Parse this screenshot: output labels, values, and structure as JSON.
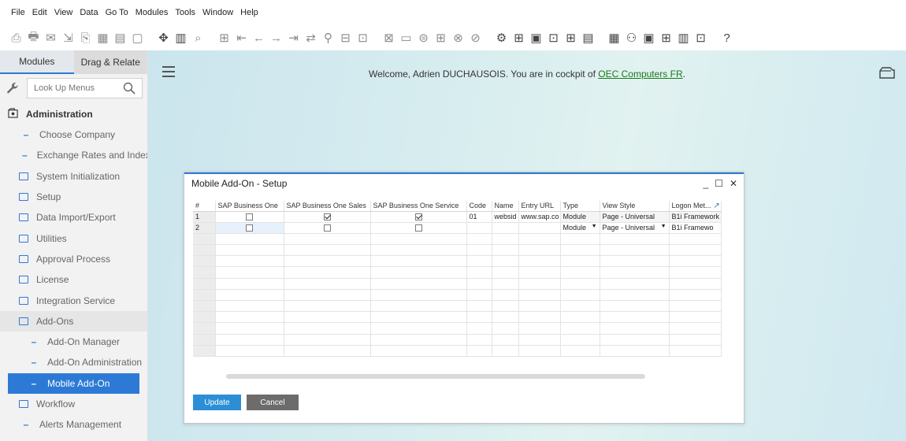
{
  "menu": [
    "File",
    "Edit",
    "View",
    "Data",
    "Go To",
    "Modules",
    "Tools",
    "Window",
    "Help"
  ],
  "toolbar_icons": [
    "print-preview-icon",
    "print-icon",
    "email-icon",
    "export-icon",
    "open-icon",
    "excel-icon",
    "word-icon",
    "pdf-icon",
    "move-icon",
    "layout-icon",
    "find-icon",
    "add-icon",
    "first-record-icon",
    "previous-record-icon",
    "next-record-icon",
    "last-record-icon",
    "refresh-icon",
    "filter-icon",
    "sort-icon",
    "base-document-icon",
    "target-document-icon",
    "gross-profit-icon",
    "payment-means-icon",
    "volume-weight-icon",
    "reverse-icon",
    "form-settings-icon",
    "settings-icon",
    "query-icon",
    "messages-icon",
    "alerts-icon",
    "calendar-icon",
    "calculator-icon",
    "report-icon",
    "user-icon",
    "report-designer-icon",
    "widget-icon",
    "chart-icon",
    "tools-icon",
    "help-icon"
  ],
  "sidebar": {
    "tabs": [
      "Modules",
      "Drag & Relate"
    ],
    "search_placeholder": "Look Up Menus",
    "section": "Administration",
    "items": [
      {
        "label": "Choose Company",
        "kind": "lvl1"
      },
      {
        "label": "Exchange Rates and Indexes",
        "kind": "lvl1"
      },
      {
        "label": "System Initialization",
        "kind": "folder"
      },
      {
        "label": "Setup",
        "kind": "folder"
      },
      {
        "label": "Data Import/Export",
        "kind": "folder"
      },
      {
        "label": "Utilities",
        "kind": "folder"
      },
      {
        "label": "Approval Process",
        "kind": "folder"
      },
      {
        "label": "License",
        "kind": "folder"
      },
      {
        "label": "Integration Service",
        "kind": "folder"
      },
      {
        "label": "Add-Ons",
        "kind": "folder"
      },
      {
        "label": "Add-On Manager",
        "kind": "lvl2"
      },
      {
        "label": "Add-On Administration",
        "kind": "lvl2"
      },
      {
        "label": "Mobile Add-On",
        "kind": "lvl2"
      },
      {
        "label": "Workflow",
        "kind": "folder"
      },
      {
        "label": "Alerts Management",
        "kind": "lvl1"
      }
    ]
  },
  "main": {
    "welcome_prefix": "Welcome, Adrien DUCHAUSOIS. You are in cockpit of",
    "company_link": "OEC Computers FR",
    "welcome_suffix": "."
  },
  "dialog": {
    "title": "Mobile Add-On - Setup",
    "minimize": "_",
    "maximize": "☐",
    "close": "✕",
    "columns": [
      "#",
      "SAP Business One",
      "SAP Business One Sales",
      "SAP Business One Service",
      "Code",
      "Name",
      "Entry URL",
      "Type",
      "View Style",
      "Logon Met..."
    ],
    "rows": [
      {
        "num": "1",
        "b1": false,
        "sales": true,
        "service": true,
        "code": "01",
        "name": "websid",
        "url": "www.sap.co",
        "type": "Module",
        "view": "Page - Universal",
        "logon": "B1i Framework"
      },
      {
        "num": "2",
        "b1": false,
        "sales": false,
        "service": false,
        "code": "",
        "name": "",
        "url": "",
        "type": "Module",
        "view": "Page - Universal",
        "logon": "B1i Framewo"
      }
    ],
    "empty_rows": 11,
    "update_label": "Update",
    "cancel_label": "Cancel"
  }
}
